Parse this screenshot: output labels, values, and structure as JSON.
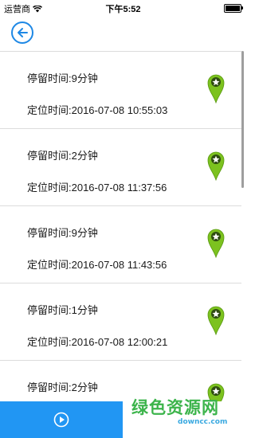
{
  "status_bar": {
    "carrier": "运营商",
    "time": "下午5:52"
  },
  "nav": {
    "back_icon": "back-arrow-circle-icon"
  },
  "records": [
    {
      "stay_time": "停留时间:9分钟",
      "locate_time": "定位时间:2016-07-08 10:55:03"
    },
    {
      "stay_time": "停留时间:2分钟",
      "locate_time": "定位时间:2016-07-08 11:37:56"
    },
    {
      "stay_time": "停留时间:9分钟",
      "locate_time": "定位时间:2016-07-08 11:43:56"
    },
    {
      "stay_time": "停留时间:1分钟",
      "locate_time": "定位时间:2016-07-08 12:00:21"
    },
    {
      "stay_time": "停留时间:2分钟",
      "locate_time": ""
    }
  ],
  "bottom": {
    "play_icon": "play-circle-icon",
    "watermark_main": "绿色资源网",
    "watermark_sub": "downcc.com"
  },
  "colors": {
    "accent": "#2196f3",
    "pin": "#7cc21f",
    "divider": "#dcdcdc"
  }
}
